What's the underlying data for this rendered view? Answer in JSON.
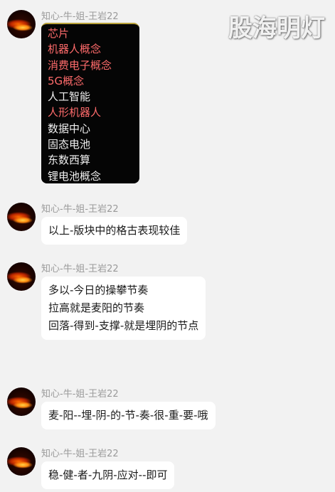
{
  "watermark": "股海明灯",
  "messages": [
    {
      "sender": "知心-牛-姐-王岩22",
      "type": "image",
      "lines": [
        {
          "text": "芯片",
          "color": "#ff6b6b"
        },
        {
          "text": "机器人概念",
          "color": "#ff6b6b"
        },
        {
          "text": "消费电子概念",
          "color": "#ff6b6b"
        },
        {
          "text": "5G概念",
          "color": "#ff6b6b"
        },
        {
          "text": "人工智能",
          "color": "#f0f0f0"
        },
        {
          "text": "人形机器人",
          "color": "#ff6b6b"
        },
        {
          "text": "数据中心",
          "color": "#f0f0f0"
        },
        {
          "text": "固态电池",
          "color": "#f0f0f0"
        },
        {
          "text": "东数西算",
          "color": "#f0f0f0"
        },
        {
          "text": "锂电池概念",
          "color": "#f0f0f0"
        }
      ]
    },
    {
      "sender": "知心-牛-姐-王岩22",
      "type": "text",
      "lines": [
        "以上-版块中的格古表现较佳"
      ]
    },
    {
      "sender": "知心-牛-姐-王岩22",
      "type": "text",
      "lines": [
        "多以-今日的操攀节奏",
        "拉高就是麦阳的节奏",
        "回落-得到-支撑-就是埋阴的节点"
      ]
    },
    {
      "sender": "知心-牛-姐-王岩22",
      "type": "text",
      "lines": [
        "麦-阳--埋-阴-的-节-奏-很-重-要-哦"
      ]
    },
    {
      "sender": "知心-牛-姐-王岩22",
      "type": "text",
      "lines": [
        "稳-健-者-九阴-应对--即可"
      ]
    }
  ]
}
